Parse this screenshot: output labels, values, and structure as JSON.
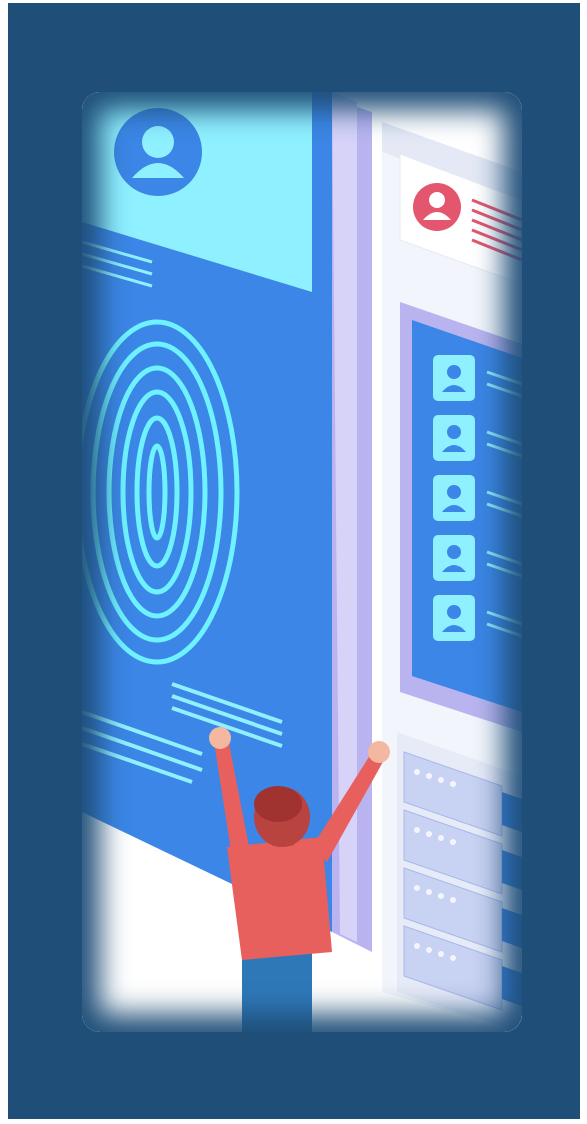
{
  "scene": {
    "colors": {
      "frame": "#1f4e78",
      "phone": "#3b86e6",
      "accent_cyan": "#6ff2ff",
      "panel_lavender": "#b9b4ef",
      "person_shirt": "#e8605d",
      "person_hair": "#b8433f",
      "person_pants": "#2f78b8",
      "avatar_red": "#e3566e"
    },
    "elements": [
      "fingerprint-icon",
      "user-avatar-icon",
      "user-list",
      "server-racks",
      "person-celebrating"
    ]
  }
}
